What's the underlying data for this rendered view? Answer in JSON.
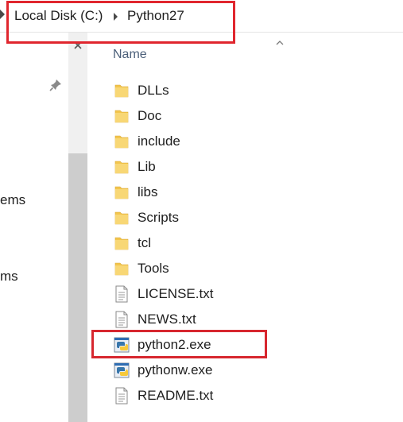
{
  "colors": {
    "highlight": "#d7272f",
    "folder": "#f3c54c",
    "header_text": "#4c607a",
    "scrollbar_track": "#f0f0f0",
    "scrollbar_thumb": "#cdcdcd"
  },
  "breadcrumb": {
    "items": [
      "Local Disk (C:)",
      "Python27"
    ],
    "separator_icon": "chevron-right-icon"
  },
  "nav_pane": {
    "pin_icon": "pin-icon",
    "visible_text": [
      "ems",
      "ms"
    ]
  },
  "file_list": {
    "column_header": "Name",
    "sort_icon": "sort-up-chevron-icon",
    "items": [
      {
        "name": "DLLs",
        "type": "folder"
      },
      {
        "name": "Doc",
        "type": "folder"
      },
      {
        "name": "include",
        "type": "folder"
      },
      {
        "name": "Lib",
        "type": "folder"
      },
      {
        "name": "libs",
        "type": "folder"
      },
      {
        "name": "Scripts",
        "type": "folder"
      },
      {
        "name": "tcl",
        "type": "folder"
      },
      {
        "name": "Tools",
        "type": "folder"
      },
      {
        "name": "LICENSE.txt",
        "type": "text"
      },
      {
        "name": "NEWS.txt",
        "type": "text"
      },
      {
        "name": "python2.exe",
        "type": "python-exe"
      },
      {
        "name": "pythonw.exe",
        "type": "python-exe"
      },
      {
        "name": "README.txt",
        "type": "text"
      }
    ]
  }
}
